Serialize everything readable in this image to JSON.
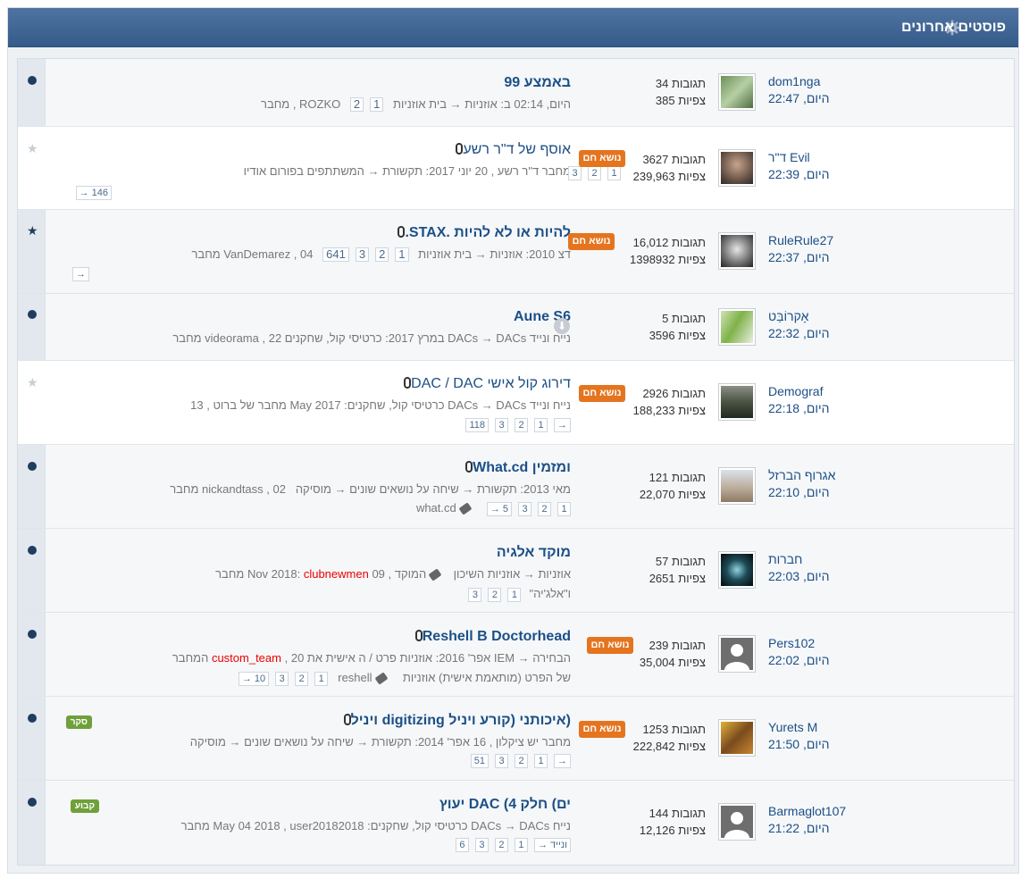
{
  "header": {
    "title": "פוסטים אחרונים",
    "settings_icon": "gear-icon"
  },
  "labels": {
    "replies": "תגובות",
    "views": "צפיות",
    "hot": "נושא חם",
    "today": "היום,"
  },
  "topics": [
    {
      "title": "באמצע 99",
      "meta": "היום, 02:14 ב: אוזניות → בית אוזניות",
      "pages": [
        "1",
        "2"
      ],
      "author_line": "ROZKO , מחבר",
      "replies": "34",
      "views": "385",
      "last_poster": "dom1nga",
      "last_time": "22:47"
    },
    {
      "title": "אוסף של ד\"ר רשע",
      "meta": "מחבר ד\"ר רשע , 20 יוני 2017: תקשורת → המשתתפים בפורום אודיו",
      "pages": [
        "1",
        "2",
        "3",
        "146 →"
      ],
      "replies": "3627",
      "views": "239,963",
      "hot": true,
      "last_poster": "ד\"ר Evil",
      "last_time": "22:39"
    },
    {
      "title": "להיות או לא להיות .STAX.",
      "meta": "דצ 2010: אוזניות → בית אוזניות",
      "pages": [
        "1",
        "2",
        "3",
        "641"
      ],
      "author_line": "VanDemarez , 04 מחבר",
      "extra_arrow": "→",
      "replies": "16,012",
      "views": "1398932",
      "hot": true,
      "last_poster": "RuleRule27",
      "last_time": "22:37"
    },
    {
      "title": "Aune S6",
      "meta": "נייח ונייד DACs → DACs במרץ 2017: כרטיסי קול, שחקנים 22 , videorama מחבר",
      "replies": "5",
      "views": "3596",
      "last_poster": "אָקרוֹבַּט",
      "last_time": "22:32"
    },
    {
      "title": "דירוג קול אישי DAC / DAC",
      "meta": "נייח ונייד DACs → DACs כרטיסי קול, שחקנים: May 2017 מחבר של ברוט , 13",
      "pages": [
        "→",
        "1",
        "2",
        "3",
        "118"
      ],
      "replies": "2926",
      "views": "188,233",
      "hot": true,
      "last_poster": "Demograf",
      "last_time": "22:18"
    },
    {
      "title": "ומזמין What.cd",
      "meta": "מאי 2013: תקשורת → שיחה על נושאים שונים → מוסיקה",
      "author_line": "nickandtass , 02 מחבר",
      "tag": "what.cd",
      "pages": [
        "1",
        "2",
        "3",
        "5 →"
      ],
      "replies": "121",
      "views": "22,070",
      "last_poster": "אגרוף הברזל",
      "last_time": "22:10"
    },
    {
      "title": "מוקד אלגיה",
      "meta": "אוזניות → אוזניות השיכון",
      "tag": "המוקד",
      "date": ", 09 Nov 2018:",
      "author_red": "clubnewmen",
      "author_suffix": "מחבר",
      "sub": "ו\"אלג'יה\"",
      "pages": [
        "1",
        "2",
        "3"
      ],
      "replies": "57",
      "views": "2651",
      "last_poster": "חברות",
      "last_time": "22:03"
    },
    {
      "title": "Reshell B Doctorhead",
      "meta": "הבחירה → IEM אפר' 2016: אוזניות פרט / ה אישית את 20 ,",
      "author_red": "custom_team",
      "author_suffix": "המחבר",
      "sub": "של הפרט (מותאמת אישית) אוזניות",
      "tag": "reshell",
      "pages": [
        "1",
        "2",
        "3",
        "10 →"
      ],
      "replies": "239",
      "views": "35,004",
      "hot": true,
      "last_poster": "Pers102",
      "last_time": "22:02"
    },
    {
      "title": "(איכותני (קורע ויניל digitizing ויניל",
      "badge": "סקר",
      "meta": "מחבר יש ציקלון , 16 אפר' 2014: תקשורת → שיחה על נושאים שונים → מוסיקה",
      "pages": [
        "→",
        "1",
        "2",
        "3",
        "51"
      ],
      "replies": "1253",
      "views": "222,842",
      "hot": true,
      "last_poster": "Yurets M",
      "last_time": "21:50"
    },
    {
      "title": "ים) חלק 4) DAC יעוץ",
      "badge": "קבוע",
      "meta": "נייח DACs → DACs כרטיסי קול, שחקנים: May 04 2018 , user20182018 מחבר",
      "pages": [
        "ונייד →",
        "1",
        "2",
        "3",
        "6"
      ],
      "replies": "144",
      "views": "12,126",
      "last_poster": "Barmaglot107",
      "last_time": "21:22"
    }
  ]
}
